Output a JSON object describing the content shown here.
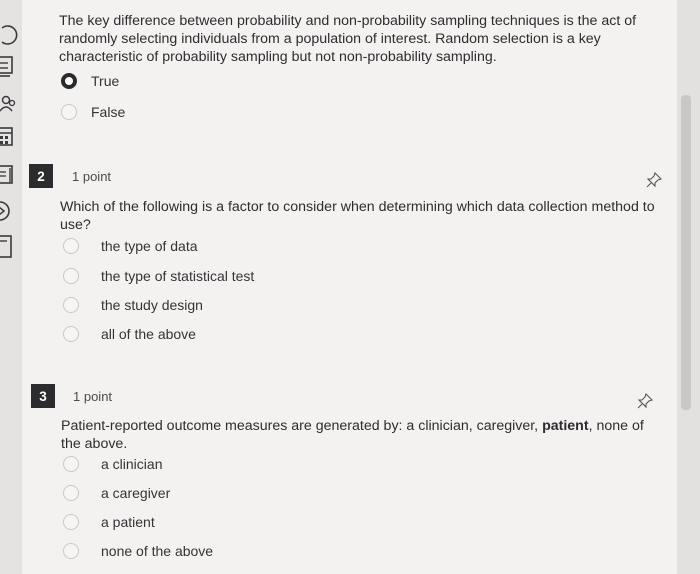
{
  "question1": {
    "text": "The key difference between probability and non-probability sampling techniques is the act of randomly selecting individuals from a population of interest. Random selection is a key characteristic of probability sampling but not non-probability sampling.",
    "options": [
      "True",
      "False"
    ],
    "selected": "True"
  },
  "question2": {
    "number": "2",
    "points": "1 point",
    "text": "Which of the following is a factor to consider when determining which data collection method to use?",
    "options": [
      "the type of data",
      "the type of statistical test",
      "the study design",
      "all of the above"
    ]
  },
  "question3": {
    "number": "3",
    "points": "1 point",
    "text_before": "Patient-reported outcome measures are generated by:  a clinician, caregiver, ",
    "text_bold": "patient",
    "text_after": ", none of the above.",
    "options": [
      "a clinician",
      "a caregiver",
      "a patient",
      "none of the above"
    ]
  },
  "icons": {
    "pin": "pin-icon",
    "sidebar": [
      "history-icon",
      "grades-icon",
      "people-icon",
      "calendar-icon",
      "inbox-icon",
      "help-icon",
      "page-icon"
    ]
  },
  "colors": {
    "background": "#f3f2f0",
    "badge": "#2c2c2e",
    "radio_border": "#c9c8c6"
  }
}
